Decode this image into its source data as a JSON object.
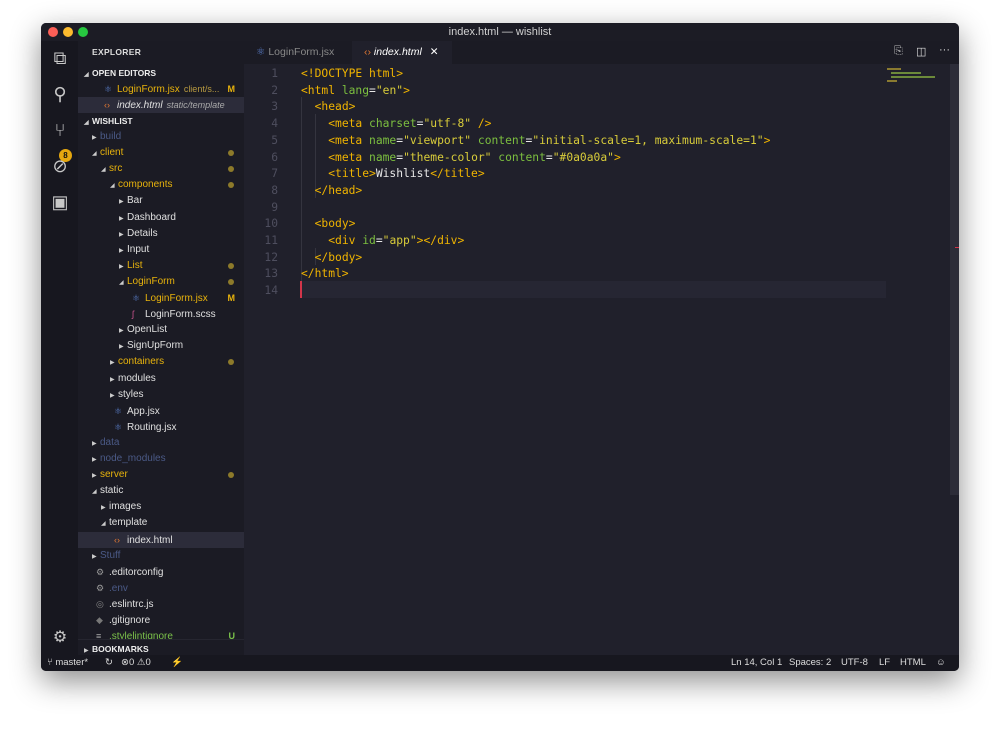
{
  "window": {
    "title": "index.html — wishlist"
  },
  "activity_bar": {
    "items": [
      "explorer",
      "search",
      "source-control",
      "debug",
      "extensions"
    ],
    "scm_badge": "8"
  },
  "sidebar": {
    "title": "EXPLORER",
    "open_editors_label": "OPEN EDITORS",
    "open_editors": [
      {
        "name": "LoginForm.jsx",
        "desc": "client/s...",
        "flag": "M",
        "icon": "react-icon"
      },
      {
        "name": "index.html",
        "desc": "static/template",
        "icon": "html-icon"
      }
    ],
    "project_label": "WISHLIST",
    "tree": [
      {
        "name": "build",
        "depth": 0,
        "type": "folder",
        "open": false,
        "style": "dim"
      },
      {
        "name": "client",
        "depth": 0,
        "type": "folder",
        "open": true,
        "style": "y",
        "dot": true
      },
      {
        "name": "src",
        "depth": 1,
        "type": "folder",
        "open": true,
        "style": "y",
        "dot": true
      },
      {
        "name": "components",
        "depth": 2,
        "type": "folder",
        "open": true,
        "style": "y",
        "dot": true
      },
      {
        "name": "Bar",
        "depth": 3,
        "type": "folder",
        "open": false
      },
      {
        "name": "Dashboard",
        "depth": 3,
        "type": "folder",
        "open": false
      },
      {
        "name": "Details",
        "depth": 3,
        "type": "folder",
        "open": false
      },
      {
        "name": "Input",
        "depth": 3,
        "type": "folder",
        "open": false
      },
      {
        "name": "List",
        "depth": 3,
        "type": "folder",
        "open": false,
        "style": "y",
        "dot": true
      },
      {
        "name": "LoginForm",
        "depth": 3,
        "type": "folder",
        "open": true,
        "style": "y",
        "dot": true
      },
      {
        "name": "LoginForm.jsx",
        "depth": 4,
        "type": "react",
        "style": "y",
        "flag": "M"
      },
      {
        "name": "LoginForm.scss",
        "depth": 4,
        "type": "sass"
      },
      {
        "name": "OpenList",
        "depth": 3,
        "type": "folder",
        "open": false
      },
      {
        "name": "SignUpForm",
        "depth": 3,
        "type": "folder",
        "open": false
      },
      {
        "name": "containers",
        "depth": 2,
        "type": "folder",
        "open": false,
        "style": "y",
        "dot": true
      },
      {
        "name": "modules",
        "depth": 2,
        "type": "folder",
        "open": false
      },
      {
        "name": "styles",
        "depth": 2,
        "type": "folder",
        "open": false
      },
      {
        "name": "App.jsx",
        "depth": 2,
        "type": "react"
      },
      {
        "name": "Routing.jsx",
        "depth": 2,
        "type": "react"
      },
      {
        "name": "data",
        "depth": 0,
        "type": "folder",
        "open": false,
        "style": "dim"
      },
      {
        "name": "node_modules",
        "depth": 0,
        "type": "folder",
        "open": false,
        "style": "dim"
      },
      {
        "name": "server",
        "depth": 0,
        "type": "folder",
        "open": false,
        "style": "y",
        "dot": true
      },
      {
        "name": "static",
        "depth": 0,
        "type": "folder",
        "open": true
      },
      {
        "name": "images",
        "depth": 1,
        "type": "folder",
        "open": false
      },
      {
        "name": "template",
        "depth": 1,
        "type": "folder",
        "open": true
      },
      {
        "name": "index.html",
        "depth": 2,
        "type": "html",
        "selected": true
      },
      {
        "name": "Stuff",
        "depth": 0,
        "type": "folder",
        "open": false,
        "style": "dim"
      },
      {
        "name": ".editorconfig",
        "depth": 0,
        "type": "gear"
      },
      {
        "name": ".env",
        "depth": 0,
        "type": "gear",
        "style": "dim"
      },
      {
        "name": ".eslintrc.js",
        "depth": 0,
        "type": "eslint"
      },
      {
        "name": ".gitignore",
        "depth": 0,
        "type": "git"
      },
      {
        "name": ".stylelintignore",
        "depth": 0,
        "type": "file",
        "style": "g",
        "flag": "U"
      }
    ],
    "bookmarks_label": "BOOKMARKS"
  },
  "tabs": [
    {
      "label": "LoginForm.jsx",
      "active": false
    },
    {
      "label": "index.html",
      "active": true
    }
  ],
  "editor": {
    "lines": [
      [
        [
          "t",
          "<!DOCTYPE html>"
        ]
      ],
      [
        [
          "t",
          "<html "
        ],
        [
          "a",
          "lang"
        ],
        [
          "p",
          "="
        ],
        [
          "s",
          "\"en\""
        ],
        [
          "t",
          ">"
        ]
      ],
      [
        [
          "p",
          "  "
        ],
        [
          "t",
          "<head>"
        ]
      ],
      [
        [
          "p",
          "    "
        ],
        [
          "t",
          "<meta "
        ],
        [
          "a",
          "charset"
        ],
        [
          "p",
          "="
        ],
        [
          "s",
          "\"utf-8\""
        ],
        [
          "p",
          " "
        ],
        [
          "t",
          "/>"
        ]
      ],
      [
        [
          "p",
          "    "
        ],
        [
          "t",
          "<meta "
        ],
        [
          "a",
          "name"
        ],
        [
          "p",
          "="
        ],
        [
          "s",
          "\"viewport\""
        ],
        [
          "p",
          " "
        ],
        [
          "a",
          "content"
        ],
        [
          "p",
          "="
        ],
        [
          "s",
          "\"initial-scale=1, maximum-scale=1\""
        ],
        [
          "t",
          ">"
        ]
      ],
      [
        [
          "p",
          "    "
        ],
        [
          "t",
          "<meta "
        ],
        [
          "a",
          "name"
        ],
        [
          "p",
          "="
        ],
        [
          "s",
          "\"theme-color\""
        ],
        [
          "p",
          " "
        ],
        [
          "a",
          "content"
        ],
        [
          "p",
          "="
        ],
        [
          "s",
          "\"#0a0a0a\""
        ],
        [
          "t",
          ">"
        ]
      ],
      [
        [
          "p",
          "    "
        ],
        [
          "t",
          "<title>"
        ],
        [
          "p",
          "Wishlist"
        ],
        [
          "t",
          "</title>"
        ]
      ],
      [
        [
          "p",
          "  "
        ],
        [
          "t",
          "</head>"
        ]
      ],
      [],
      [
        [
          "p",
          "  "
        ],
        [
          "t",
          "<body>"
        ]
      ],
      [
        [
          "p",
          "    "
        ],
        [
          "t",
          "<div "
        ],
        [
          "a",
          "id"
        ],
        [
          "p",
          "="
        ],
        [
          "s",
          "\"app\""
        ],
        [
          "t",
          "></div>"
        ]
      ],
      [
        [
          "p",
          "  "
        ],
        [
          "t",
          "</body>"
        ]
      ],
      [
        [
          "t",
          "</html>"
        ]
      ],
      []
    ]
  },
  "status": {
    "branch": "master*",
    "errors": "0",
    "warnings": "0",
    "position": "Ln 14, Col 1",
    "spaces": "Spaces: 2",
    "encoding": "UTF-8",
    "eol": "LF",
    "language": "HTML"
  },
  "colors": {
    "tag": "#f0b400",
    "attr": "#7cbf3f",
    "string": "#d8cc3a",
    "modified": "#e8b30c",
    "untracked": "#7bc24a",
    "cursor": "#d2354a"
  }
}
